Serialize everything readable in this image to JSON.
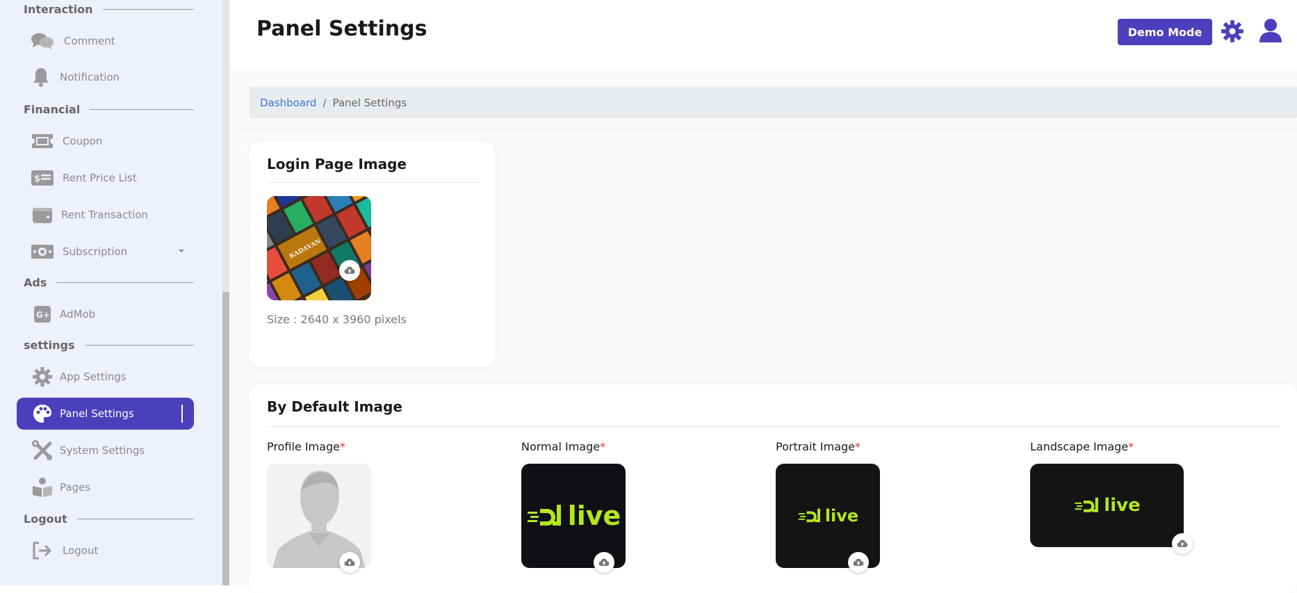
{
  "sidebar": {
    "sections": {
      "interaction": "Interaction",
      "financial": "Financial",
      "ads": "Ads",
      "settings": "settings",
      "logout": "Logout"
    },
    "items": {
      "comment": "Comment",
      "notification": "Notification",
      "coupon": "Coupon",
      "rent_price_list": "Rent Price List",
      "rent_transaction": "Rent Transaction",
      "subscription": "Subscription",
      "admob": "AdMob",
      "app_settings": "App Settings",
      "panel_settings": "Panel Settings",
      "system_settings": "System Settings",
      "pages": "Pages",
      "logout": "Logout"
    },
    "icons": {
      "comment": "comments-icon",
      "notification": "bell-icon",
      "coupon": "ticket-icon",
      "rent_price_list": "price-list-icon",
      "rent_transaction": "wallet-icon",
      "subscription": "money-bill-icon",
      "admob": "google-plus-icon",
      "app_settings": "gear-icon",
      "panel_settings": "palette-icon",
      "system_settings": "tools-icon",
      "pages": "book-reader-icon",
      "logout": "sign-out-icon"
    },
    "active_item": "panel_settings"
  },
  "header": {
    "title": "Panel Settings",
    "demo_mode_label": "Demo Mode"
  },
  "breadcrumb": {
    "link": "Dashboard",
    "separator": "/",
    "current": "Panel Settings"
  },
  "login_card": {
    "title": "Login Page Image",
    "size_text": "Size : 2640 x 3960 pixels",
    "poster_caption": "KADAVAN"
  },
  "default_card": {
    "title": "By Default Image",
    "images": [
      {
        "label": "Profile Image",
        "required": "*"
      },
      {
        "label": "Normal Image",
        "required": "*"
      },
      {
        "label": "Portrait Image",
        "required": "*"
      },
      {
        "label": "Landscape Image",
        "required": "*"
      }
    ],
    "logo_text": "live"
  },
  "colors": {
    "accent": "#4b3fbc",
    "sidebar_bg": "#eef0fb",
    "logo_green": "#b4e61e",
    "required": "#e03030",
    "link": "#3a76d6"
  }
}
